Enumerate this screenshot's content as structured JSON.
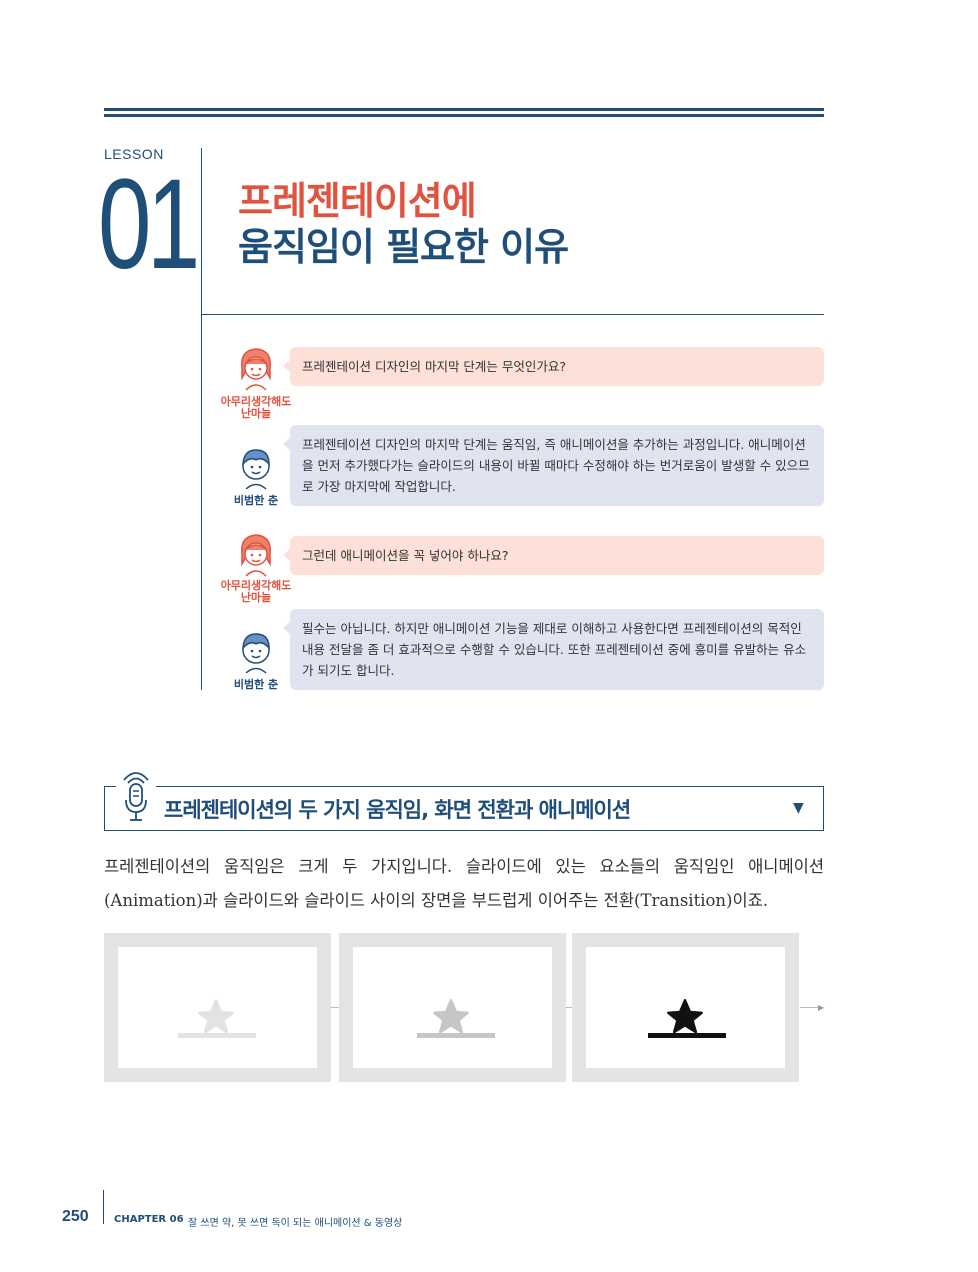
{
  "lesson": {
    "label": "LESSON",
    "number": "01"
  },
  "title": {
    "line1": "프레젠테이션에",
    "line2": "움직임이 필요한 이유"
  },
  "dialogue": [
    {
      "speaker": "아무리생각해도\n난마늘",
      "type": "question",
      "text": "프레젠테이션 디자인의 마지막 단계는 무엇인가요?"
    },
    {
      "speaker": "비범한 춘",
      "type": "answer",
      "text": "프레젠테이션 디자인의 마지막 단계는 움직임, 즉 애니메이션을 추가하는 과정입니다. 애니메이션을 먼저 추가했다가는 슬라이드의 내용이 바뀔 때마다 수정해야 하는 번거로움이 발생할 수 있으므로 가장 마지막에 작업합니다."
    },
    {
      "speaker": "아무리생각해도\n난마늘",
      "type": "question",
      "text": "그런데 애니메이션을 꼭 넣어야 하나요?"
    },
    {
      "speaker": "비범한 춘",
      "type": "answer",
      "text": "필수는 아닙니다. 하지만 애니메이션 기능을 제대로 이해하고 사용한다면 프레젠테이션의 목적인 내용 전달을 좀 더 효과적으로 수행할 수 있습니다. 또한 프레젠테이션 중에 흥미를 유발하는 유소가 되기도 합니다."
    }
  ],
  "section": {
    "title": "프레젠테이션의 두 가지 움직임, 화면 전환과 애니메이션",
    "toggle_icon": "triangle-down-icon"
  },
  "body": "프레젠테이션의 움직임은 크게 두 가지입니다. 슬라이드에 있는 요소들의 움직임인 애니메이션(Animation)과 슬라이드와 슬라이드 사이의 장면을 부드럽게 이어주는 전환(Transition)이죠.",
  "frames": [
    {
      "icon": "star-icon",
      "color": "#e3e3e3"
    },
    {
      "icon": "star-icon",
      "color": "#c6c6c6"
    },
    {
      "icon": "star-icon",
      "color": "#111111"
    }
  ],
  "footer": {
    "page": "250",
    "chapter": "CHAPTER 06",
    "chapter_title": "잘 쓰면 약, 못 쓰면 독이 되는 애니메이션 & 동영상"
  },
  "colors": {
    "navy": "#1f4e79",
    "coral": "#e0533f",
    "question_bg": "#fde0d8",
    "answer_bg": "#dfe4f0"
  }
}
